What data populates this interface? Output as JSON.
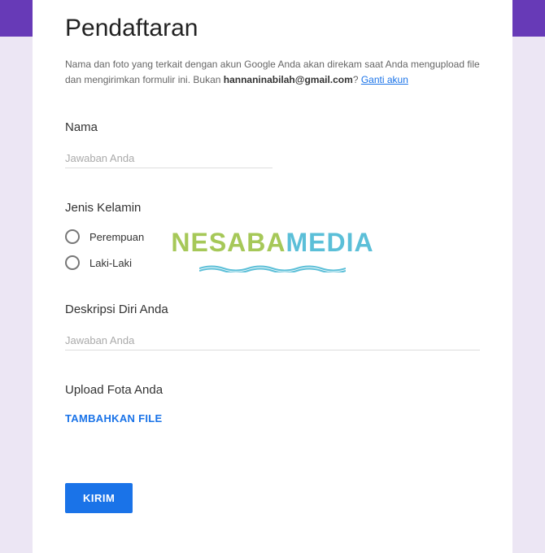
{
  "title": "Pendaftaran",
  "description": {
    "text1": "Nama dan foto yang terkait dengan akun Google Anda akan direkam saat Anda mengupload file dan mengirimkan formulir ini. Bukan ",
    "email": "hannaninabilah@gmail.com",
    "text2": "? ",
    "switchLink": "Ganti akun"
  },
  "questions": {
    "name": {
      "title": "Nama",
      "placeholder": "Jawaban Anda"
    },
    "gender": {
      "title": "Jenis Kelamin",
      "options": [
        "Perempuan",
        "Laki-Laki"
      ]
    },
    "selfDesc": {
      "title": "Deskripsi Diri Anda",
      "placeholder": "Jawaban Anda"
    },
    "upload": {
      "title": "Upload Fota Anda",
      "buttonLabel": "TAMBAHKAN FILE"
    }
  },
  "submitLabel": "KIRIM",
  "watermark": {
    "part1": "NESABA",
    "part2": "MEDIA"
  }
}
